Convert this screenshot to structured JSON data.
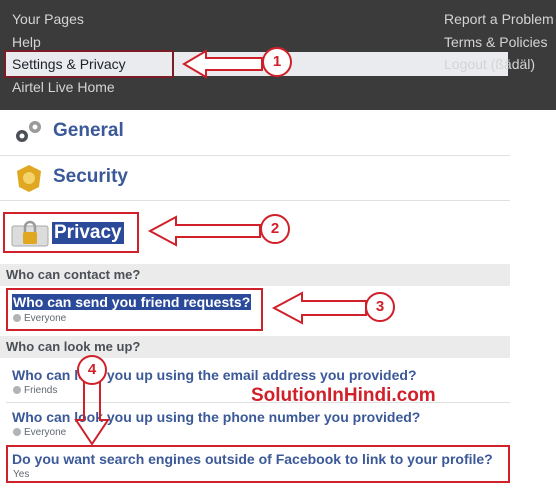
{
  "top_menu": {
    "left_items": [
      "Your Pages",
      "Help",
      "Settings & Privacy",
      "Airtel Live Home"
    ],
    "right_items": [
      "Report a Problem",
      "Terms & Policies",
      "Logout (ßädäl)"
    ]
  },
  "sections": {
    "general": "General",
    "security": "Security",
    "privacy": "Privacy"
  },
  "contact_group": {
    "heading": "Who can contact me?",
    "friend_requests": {
      "question": "Who can send you friend requests?",
      "value": "Everyone"
    }
  },
  "lookup_group": {
    "heading": "Who can look me up?",
    "email": {
      "question": "Who can look you up using the email address you provided?",
      "value": "Friends"
    },
    "phone": {
      "question": "Who can look you up using the phone number you provided?",
      "value": "Everyone"
    },
    "search_engines": {
      "question": "Do you want search engines outside of Facebook to link to your profile?",
      "value": "Yes"
    }
  },
  "annotations": {
    "step_numbers": [
      "1",
      "2",
      "3",
      "4"
    ],
    "watermark": "SolutionInHindi.com",
    "accent_color": "#d0202a"
  }
}
